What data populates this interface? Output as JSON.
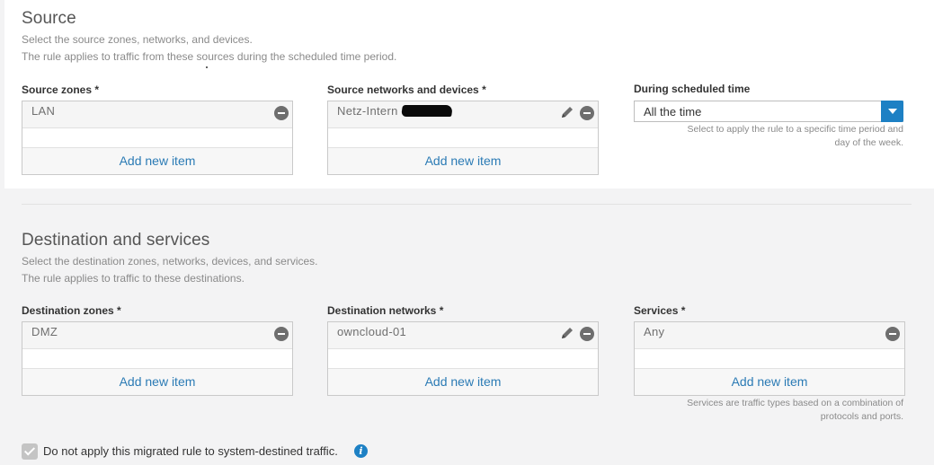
{
  "source": {
    "title": "Source",
    "desc1": "Select the source zones, networks, and devices.",
    "desc2": "The rule applies to traffic from these sources during the scheduled time period.",
    "zones_label": "Source zones *",
    "zones_item": "LAN",
    "networks_label": "Source networks and devices *",
    "networks_item": "Netz-Intern",
    "schedule_label": "During scheduled time",
    "schedule_value": "All the time",
    "schedule_hint_1": "Select to apply the rule to a specific time period and",
    "schedule_hint_2": "day of the week."
  },
  "destination": {
    "title": "Destination and services",
    "desc1": "Select the destination zones, networks, devices, and services.",
    "desc2": "The rule applies to traffic to these destinations.",
    "zones_label": "Destination zones *",
    "zones_item": "DMZ",
    "networks_label": "Destination networks *",
    "networks_item": "owncloud-01",
    "services_label": "Services *",
    "services_item": "Any",
    "services_hint_1": "Services are traffic types based on a combination of",
    "services_hint_2": "protocols and ports."
  },
  "common": {
    "add_new_item": "Add new item"
  },
  "footer": {
    "checkbox_label": "Do not apply this migrated rule to system-destined traffic.",
    "checkbox_checked": true,
    "info_glyph": "i"
  },
  "colors": {
    "accent": "#1d80c4",
    "link": "#2b7bb5"
  }
}
